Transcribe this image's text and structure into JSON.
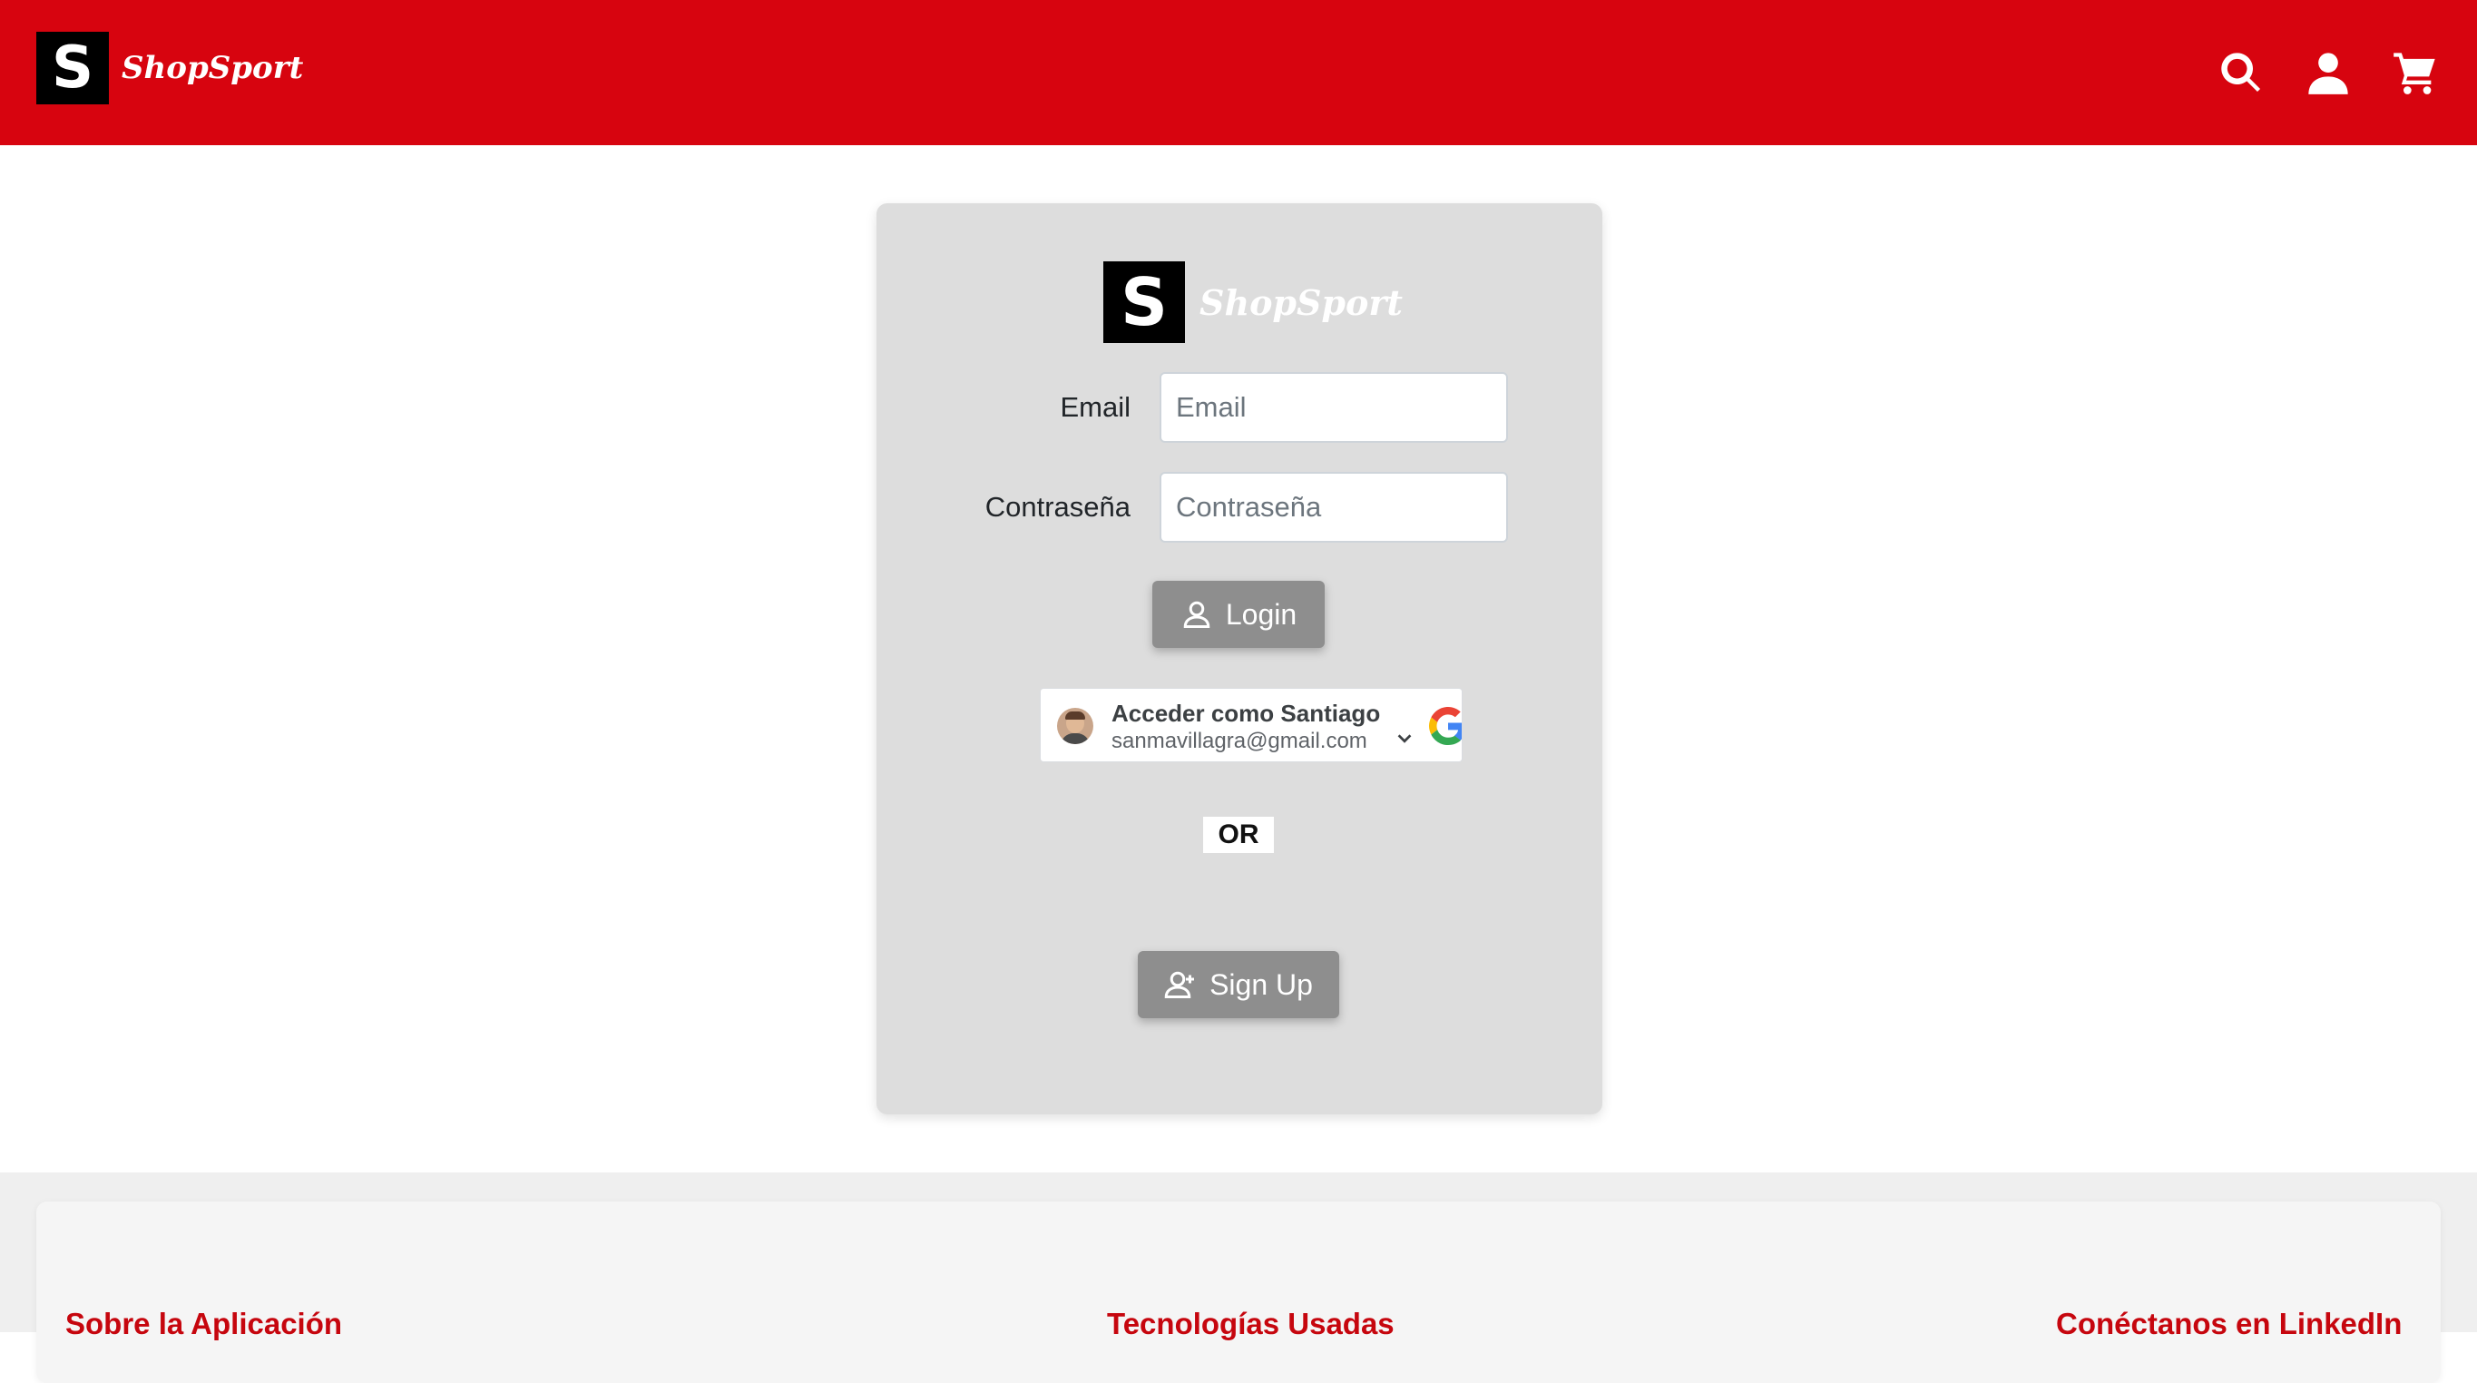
{
  "brand": {
    "logo_letter": "S",
    "name": "ShopSport"
  },
  "header": {
    "icons": [
      "search-icon",
      "user-icon",
      "cart-icon"
    ],
    "accent_color": "#d7040f"
  },
  "login": {
    "email_label": "Email",
    "email_placeholder": "Email",
    "password_label": "Contraseña",
    "password_placeholder": "Contraseña",
    "login_button": "Login",
    "google": {
      "title": "Acceder como Santiago",
      "email": "sanmavillagra@gmail.com"
    },
    "or_text": "OR",
    "signup_button": "Sign Up"
  },
  "footer": {
    "headings": [
      "Sobre la Aplicación",
      "Tecnologías Usadas",
      "Conéctanos en LinkedIn"
    ]
  }
}
